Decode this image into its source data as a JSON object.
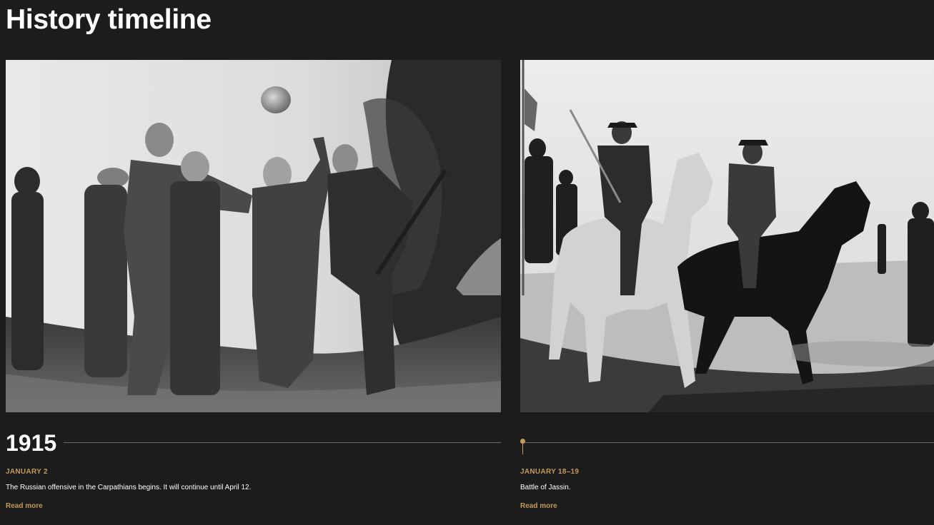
{
  "page": {
    "title": "History timeline"
  },
  "colors": {
    "background": "#1c1c1c",
    "accent": "#c49a5a",
    "text": "#ffffff",
    "divider": "#6b6b6b"
  },
  "timeline": {
    "entries": [
      {
        "year": "1915",
        "date": "JANUARY 2",
        "description": "The Russian offensive in the Carpathians begins. It will continue until April 12.",
        "read_more": "Read more"
      },
      {
        "year": "",
        "date": "JANUARY 18–19",
        "description": "Battle of Jassin.",
        "read_more": "Read more"
      }
    ]
  }
}
